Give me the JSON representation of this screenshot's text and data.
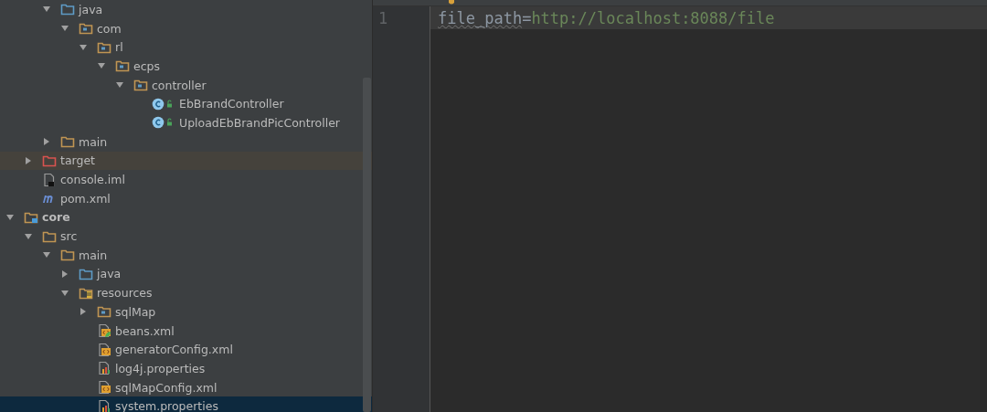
{
  "project_tree": [
    {
      "children": [
        {
          "children": [
            {
              "label": "java",
              "kind": "source-folder",
              "expanded": true,
              "selected": false,
              "children": [
                {
                  "label": "com",
                  "kind": "package",
                  "expanded": true,
                  "selected": false,
                  "children": [
                    {
                      "label": "rl",
                      "kind": "package",
                      "expanded": true,
                      "selected": false,
                      "children": [
                        {
                          "label": "ecps",
                          "kind": "package",
                          "expanded": true,
                          "selected": false,
                          "children": [
                            {
                              "label": "controller",
                              "kind": "package",
                              "expanded": true,
                              "selected": false,
                              "children": [
                                {
                                  "label": "EbBrandController",
                                  "kind": "class",
                                  "selected": false
                                },
                                {
                                  "label": "UploadEbBrandPicController",
                                  "kind": "class",
                                  "selected": false
                                }
                              ]
                            }
                          ]
                        }
                      ]
                    }
                  ]
                }
              ]
            },
            {
              "label": "main",
              "kind": "folder",
              "expanded": false,
              "selected": false
            }
          ]
        },
        {
          "label": "target",
          "kind": "excluded-folder",
          "expanded": false,
          "selected": false
        },
        {
          "label": "console.iml",
          "kind": "iml",
          "selected": false
        },
        {
          "label": "pom.xml",
          "kind": "maven",
          "selected": false
        }
      ]
    },
    {
      "label": "core",
      "kind": "module",
      "expanded": true,
      "selected": false,
      "children": [
        {
          "label": "src",
          "kind": "folder",
          "expanded": true,
          "selected": false,
          "children": [
            {
              "label": "main",
              "kind": "folder",
              "expanded": true,
              "selected": false,
              "children": [
                {
                  "label": "java",
                  "kind": "source-folder",
                  "expanded": false,
                  "selected": false
                },
                {
                  "label": "resources",
                  "kind": "resources-folder",
                  "expanded": true,
                  "selected": false,
                  "children": [
                    {
                      "label": "sqlMap",
                      "kind": "package",
                      "expanded": false,
                      "selected": false
                    },
                    {
                      "label": "beans.xml",
                      "kind": "spring-xml",
                      "selected": false
                    },
                    {
                      "label": "generatorConfig.xml",
                      "kind": "xml",
                      "selected": false
                    },
                    {
                      "label": "log4j.properties",
                      "kind": "properties",
                      "selected": false
                    },
                    {
                      "label": "sqlMapConfig.xml",
                      "kind": "xml",
                      "selected": false
                    },
                    {
                      "label": "system.properties",
                      "kind": "properties",
                      "selected": true
                    }
                  ]
                }
              ]
            }
          ]
        }
      ]
    }
  ],
  "editor": {
    "lines": [
      {
        "number": "1",
        "key": "file_path",
        "misspelled": true,
        "separator": "=",
        "value": "http://localhost:8088/file",
        "current": true
      }
    ]
  }
}
